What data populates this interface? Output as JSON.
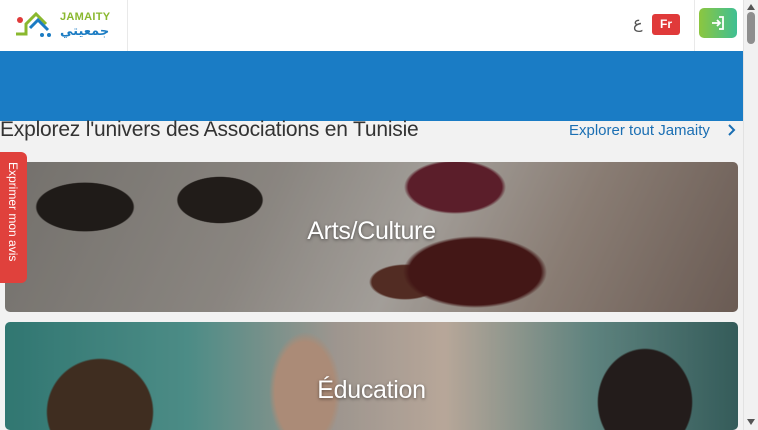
{
  "header": {
    "logo_text_en": "JAMAITY",
    "logo_text_ar": "جمعيتي",
    "lang_ar": "ع",
    "lang_fr": "Fr",
    "login_icon": "login-icon"
  },
  "section": {
    "title": "Explorez l'univers des Associations en Tunisie",
    "explore_link": "Explorer tout Jamaity"
  },
  "categories": [
    {
      "label": "Arts/Culture"
    },
    {
      "label": "Éducation"
    }
  ],
  "feedback_tab": {
    "label": "Exprimer mon avis"
  },
  "colors": {
    "brand_blue": "#1a7cc5",
    "brand_green": "#8cc63f",
    "accent_red": "#e03a3a"
  }
}
